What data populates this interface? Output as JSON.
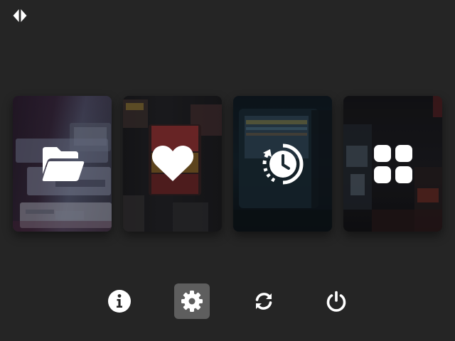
{
  "app": {
    "logo_icon": "theme-logo-icon"
  },
  "main_menu": {
    "cards": [
      {
        "id": "collections",
        "icon": "folder-open-icon"
      },
      {
        "id": "favorites",
        "icon": "heart-icon"
      },
      {
        "id": "history",
        "icon": "clock-history-icon"
      },
      {
        "id": "apps",
        "icon": "grid-icon"
      }
    ]
  },
  "footer": {
    "buttons": [
      {
        "id": "info",
        "icon": "info-icon",
        "active": false
      },
      {
        "id": "settings",
        "icon": "gear-icon",
        "active": true
      },
      {
        "id": "refresh",
        "icon": "refresh-icon",
        "active": false
      },
      {
        "id": "power",
        "icon": "power-icon",
        "active": false
      }
    ]
  },
  "colors": {
    "background": "#252525",
    "icon": "#ffffff",
    "active_button": "#5e5e5e"
  }
}
